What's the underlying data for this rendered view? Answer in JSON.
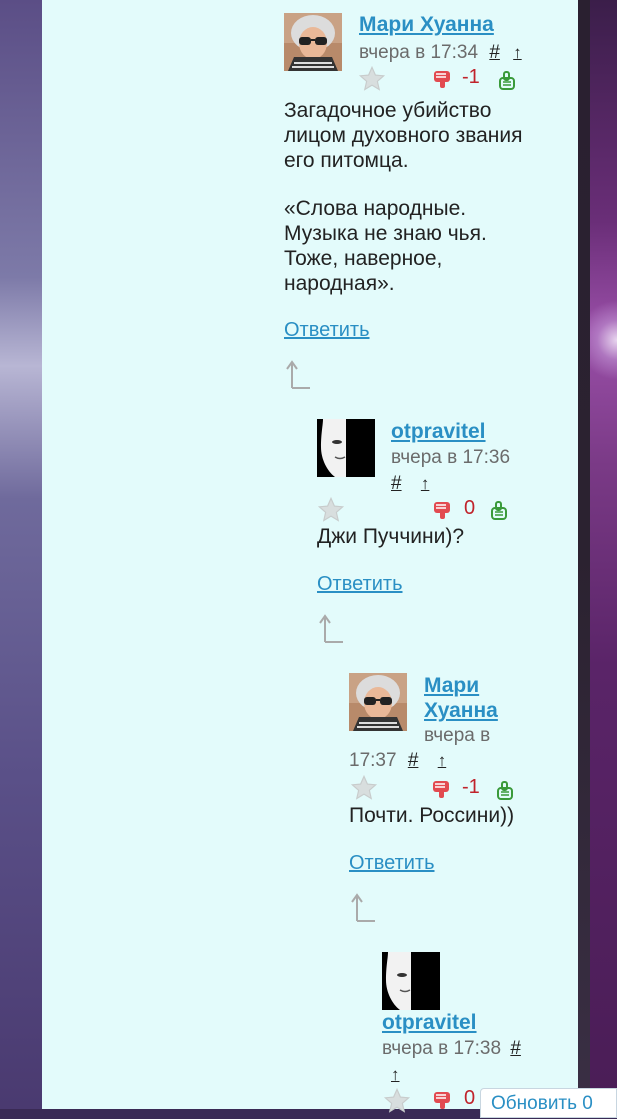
{
  "comments": [
    {
      "author": "Мари Хуанна",
      "time": "вчера в 17:34",
      "hash": "#",
      "up": "↑",
      "score": "-1",
      "text": "Загадочное убийство лицом духовного звания его питомца.",
      "text2": "«Слова народные. Музыка не знаю чья. Тоже, наверное, народная».",
      "reply": "Ответить"
    },
    {
      "author": "otpravitel",
      "time": "вчера в 17:36",
      "hash": "#",
      "up": "↑",
      "score": "0",
      "text": "Джи Пуччини)?",
      "reply": "Ответить"
    },
    {
      "author": "Мари Хуанна",
      "time_part1": "вчера в",
      "time_part2": "17:37",
      "hash": "#",
      "up": "↑",
      "score": "-1",
      "text": "Почти. Россини))",
      "reply": "Ответить"
    },
    {
      "author": "otpravitel",
      "time": "вчера в 17:38",
      "hash": "#",
      "up": "↑",
      "score": "0"
    }
  ],
  "refresh_button": "Обновить 0",
  "colors": {
    "link": "#2a8fc4",
    "negative": "#c0232b",
    "positive": "#3a9a3a",
    "panel": "#e3fbfb"
  }
}
